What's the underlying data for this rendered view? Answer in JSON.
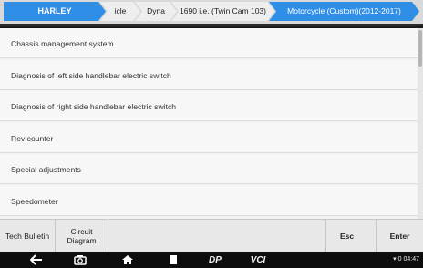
{
  "breadcrumb": {
    "items": [
      "HARLEY",
      "icle",
      "Dyna",
      "1690 i.e. (Twin Cam 103)",
      "Motorcycle (Custom)(2012-2017)"
    ]
  },
  "menu": {
    "items": [
      "Chassis management system",
      "Diagnosis of left side handlebar electric switch",
      "Diagnosis of right side handlebar electric switch",
      "Rev counter",
      "Special adjustments",
      "Speedometer"
    ]
  },
  "toolbar": {
    "tech_bulletin": "Tech Bulletin",
    "circuit_diagram_line1": "Circuit",
    "circuit_diagram_line2": "Diagram",
    "esc": "Esc",
    "enter": "Enter"
  },
  "system_bar": {
    "icons": [
      "back-icon",
      "camera-icon",
      "home-icon",
      "recent-apps-icon",
      "dp-app-icon",
      "vci-icon"
    ],
    "dp_label": "DP",
    "vci_label": "VCI",
    "time": "04:47",
    "battery": "0"
  },
  "colors": {
    "accent": "#2f8fe6",
    "list_bg": "#f7f7f7",
    "system_bar": "#0d0d0d"
  }
}
